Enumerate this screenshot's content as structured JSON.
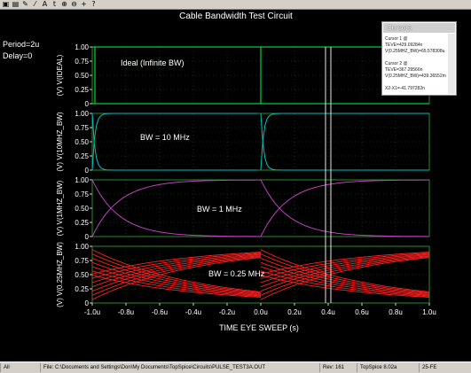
{
  "toolbar": {
    "icons": [
      {
        "name": "open-file-icon",
        "glyph": "▣"
      },
      {
        "name": "print-icon",
        "glyph": "▤"
      },
      {
        "name": "pencil-icon",
        "glyph": "✎"
      },
      {
        "name": "line-tool-icon",
        "glyph": "⁄"
      },
      {
        "name": "label-tool-icon",
        "glyph": "A"
      },
      {
        "name": "text-icon",
        "glyph": "t"
      },
      {
        "name": "zoom-in-icon",
        "glyph": "⊕"
      },
      {
        "name": "zoom-out-icon",
        "glyph": "⊖"
      },
      {
        "name": "crosshair-icon",
        "glyph": "+"
      },
      {
        "name": "help-icon",
        "glyph": "?"
      }
    ]
  },
  "plot": {
    "title": "Cable Bandwidth Test Circuit",
    "params": [
      "Period=2u",
      "Delay=0"
    ],
    "xlabel": "TIME EYE SWEEP  (s)",
    "cursor_x": 0.4
  },
  "chart_data": {
    "type": "line",
    "title": "Cable Bandwidth Test Circuit",
    "xlabel": "TIME EYE SWEEP  (s)",
    "xlim": [
      -1.0,
      1.0
    ],
    "x_ticks": [
      "-1.0u",
      "-0.8u",
      "-0.6u",
      "-0.4u",
      "-0.2u",
      "0.0u",
      "0.2u",
      "0.4u",
      "0.6u",
      "0.8u",
      "1.0u"
    ],
    "y_ticks": [
      "0",
      "0.25",
      "0.50",
      "0.75",
      "1.00"
    ],
    "grid": true,
    "panels": [
      {
        "ylabel": "(V)  V(IDEAL)",
        "annotation": "Ideal (Infinite BW)",
        "color": "#00ff40",
        "ylim": [
          0,
          1
        ]
      },
      {
        "ylabel": "(V)  V(10MHZ_BW)",
        "annotation": "BW = 10 MHz",
        "color": "#00c0c0",
        "ylim": [
          0,
          1
        ]
      },
      {
        "ylabel": "(V)  V(1MHZ_BW)",
        "annotation": "BW = 1 MHz",
        "color": "#c040c0",
        "ylim": [
          0,
          1
        ]
      },
      {
        "ylabel": "(V)  V(0.25MHZ_BW)",
        "annotation": "BW = 0.25 MHz",
        "color": "#ff2020",
        "ylim": [
          0,
          1
        ]
      }
    ]
  },
  "cursors": {
    "title": "Cursors",
    "lines": [
      "Cursor 1 @",
      "TEVE=429.09284n",
      "V(0.25MHZ_BW)=65.578308u",
      "",
      "Cursor 2 @",
      "TEVE=367.29566n",
      "V(0.25MHZ_BW)=439.36552m",
      "",
      "X2-X1=-41.797282n"
    ]
  },
  "statusbar": {
    "cells": [
      {
        "name": "status-mode",
        "text": "All"
      },
      {
        "name": "status-file",
        "text": "File: C:\\Documents and Settings\\Don\\My Documents\\TopSpice\\Circuits\\PULSE_TEST3A.OUT"
      },
      {
        "name": "status-rev",
        "text": "Rev: 161"
      },
      {
        "name": "status-version",
        "text": "TopSpice 8.02a"
      },
      {
        "name": "status-date",
        "text": "25-FE"
      }
    ]
  }
}
